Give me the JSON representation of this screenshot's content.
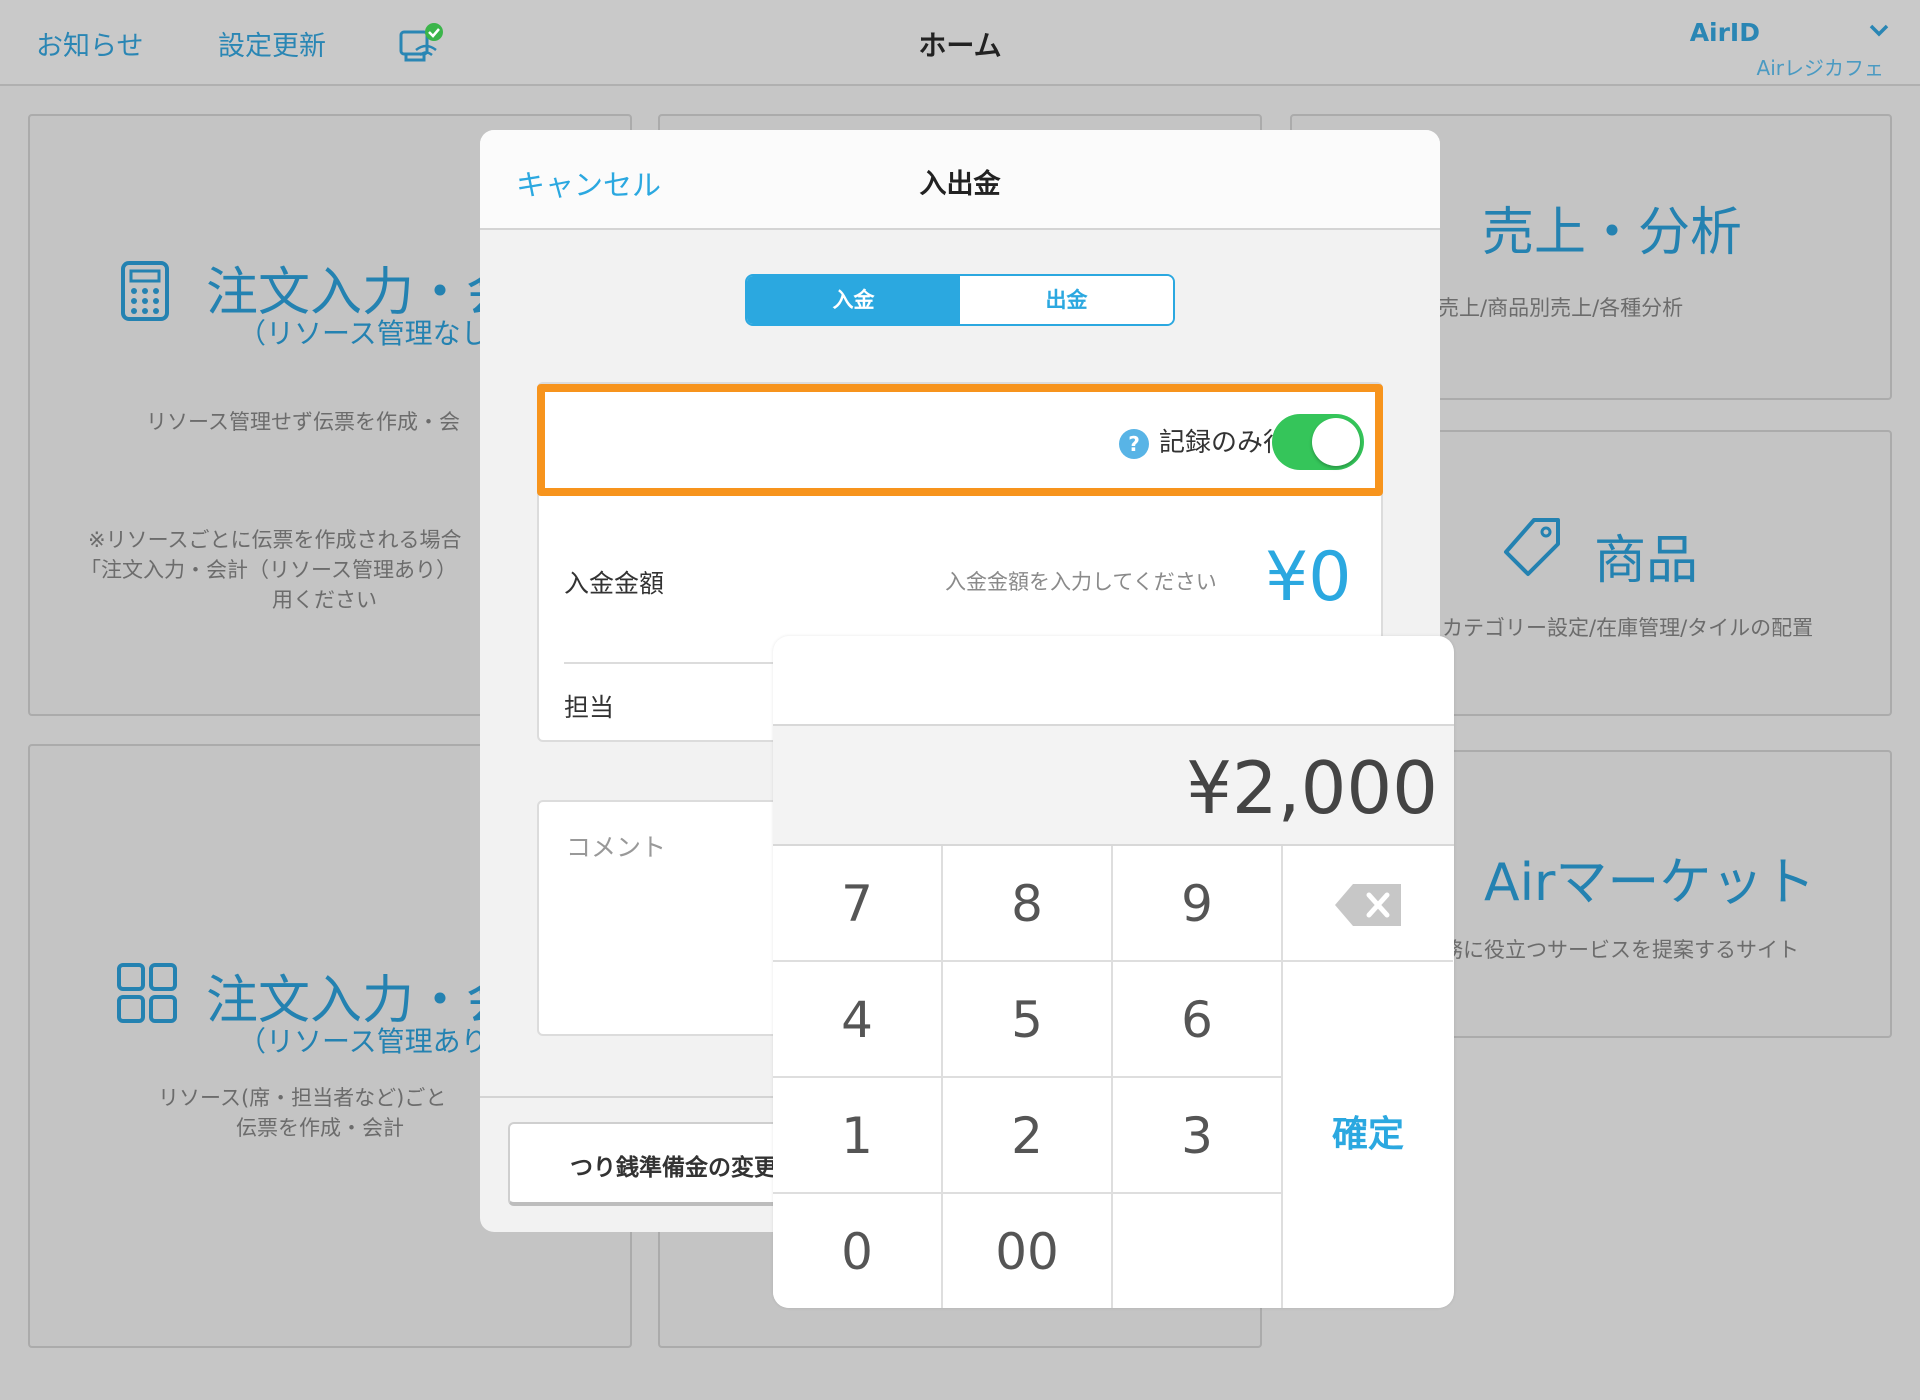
{
  "header": {
    "news": "お知らせ",
    "update": "設定更新",
    "title": "ホーム",
    "airid": "AirID",
    "store": "Airレジカフェ"
  },
  "tiles": {
    "order1": {
      "title": "注文入力・会",
      "sub": "（リソース管理なし",
      "desc": "リソース管理せず伝票を作成・会",
      "note1": "※リソースごとに伝票を作成される場合",
      "note2": "「注文入力・会計（リソース管理あり）",
      "note3": "用ください"
    },
    "order2": {
      "title": "注文入力・会",
      "sub": "（リソース管理あり",
      "desc1": "リソース(席・担当者など)ごと",
      "desc2": "伝票を作成・会計"
    },
    "sales": {
      "title": "売上・分析",
      "desc": "売上/商品別売上/各種分析"
    },
    "product": {
      "title": "商品",
      "desc": "カテゴリー設定/在庫管理/タイルの配置"
    },
    "market": {
      "title": "Airマーケット",
      "desc": "務に役立つサービスを提案するサイト"
    }
  },
  "modal": {
    "cancel": "キャンセル",
    "title": "入出金",
    "tab_in": "入金",
    "tab_out": "出金",
    "record_only_label": "記録のみ行う",
    "record_only_on": true,
    "amount_label": "入金金額",
    "amount_hint": "入金金額を入力してください",
    "amount_value": "¥0",
    "staff_label": "担当",
    "comment_placeholder": "コメント",
    "change_button": "つり銭準備金の変更"
  },
  "keypad": {
    "display": "¥2,000",
    "keys": [
      "7",
      "8",
      "9",
      "4",
      "5",
      "6",
      "1",
      "2",
      "3",
      "0",
      "00"
    ],
    "confirm": "確定"
  },
  "colors": {
    "accent": "#2ba8e0",
    "highlight": "#f7941d",
    "toggle_on": "#35c55a"
  }
}
